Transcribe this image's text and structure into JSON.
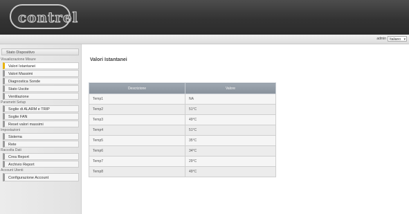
{
  "header": {
    "logo_text": "contrel"
  },
  "topbar": {
    "user": "admin",
    "language": "Italiano"
  },
  "sidebar": {
    "title": "Stato Dispositivo",
    "sections": [
      {
        "label": "Visualizzazione Misure",
        "items": [
          "Valori Istantanei",
          "Valori Massimi",
          "Diagnostica Sonde",
          "Stato Uscite",
          "Ventilazione"
        ]
      },
      {
        "label": "Parametri Setup",
        "items": [
          "Soglie di ALARM e TRIP",
          "Soglie FAN",
          "Reset valori massimi"
        ]
      },
      {
        "label": "Impostazioni",
        "items": [
          "Sistema",
          "Rete"
        ]
      },
      {
        "label": "Raccolta Dati",
        "items": [
          "Crea Report",
          "Archivio Report"
        ]
      },
      {
        "label": "Account Utenti",
        "items": [
          "Configurazione Account"
        ]
      }
    ],
    "active_item": "Valori Istantanei"
  },
  "content": {
    "title": "Valori Istantanei",
    "table": {
      "headers": [
        "Descrizione",
        "Valore"
      ],
      "rows": [
        [
          "Temp1",
          "NA"
        ],
        [
          "Temp2",
          "51°C"
        ],
        [
          "Temp3",
          "49°C"
        ],
        [
          "Temp4",
          "51°C"
        ],
        [
          "Temp5",
          "35°C"
        ],
        [
          "Temp6",
          "34°C"
        ],
        [
          "Temp7",
          "29°C"
        ],
        [
          "Temp8",
          "49°C"
        ]
      ]
    }
  },
  "colors": {
    "header_bg": "#333333",
    "active_marker": "#e9b200",
    "table_header": "#949da7"
  }
}
